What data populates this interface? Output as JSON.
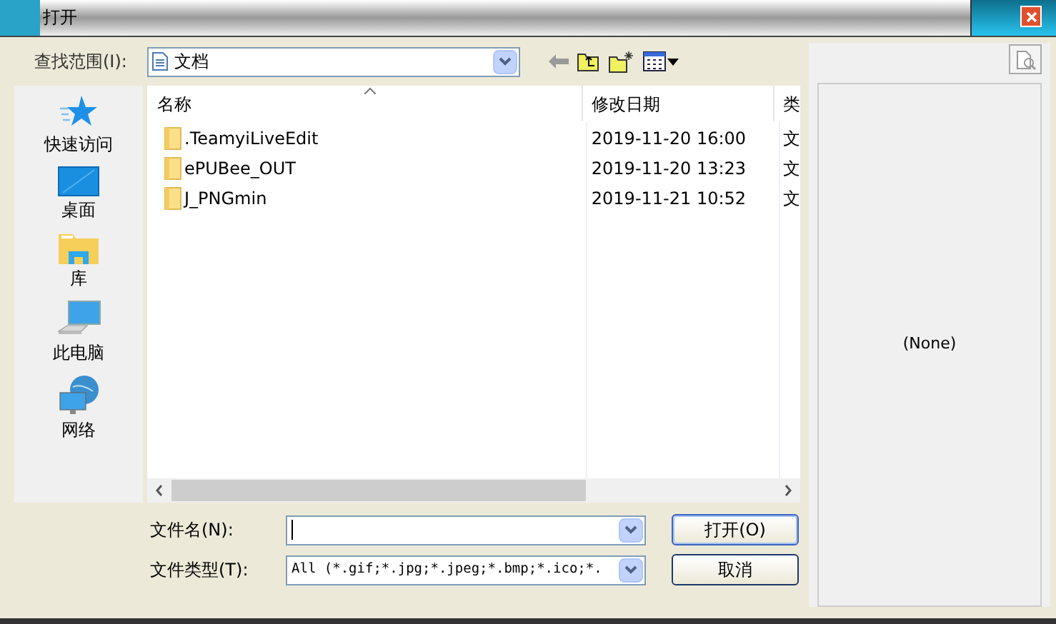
{
  "window": {
    "title": "打开"
  },
  "look_in": {
    "label": "查找范围(I):",
    "value": "文档"
  },
  "places": [
    {
      "label": "快速访问",
      "kind": "star"
    },
    {
      "label": "桌面",
      "kind": "desktop"
    },
    {
      "label": "库",
      "kind": "library"
    },
    {
      "label": "此电脑",
      "kind": "computer"
    },
    {
      "label": "网络",
      "kind": "network"
    }
  ],
  "table": {
    "columns": [
      "名称",
      "修改日期",
      "类"
    ],
    "rows": [
      {
        "name": ".TeamyiLiveEdit",
        "date": "2019-11-20 16:00",
        "column_3": "文"
      },
      {
        "name": "ePUBee_OUT",
        "date": "2019-11-20 13:23",
        "column_3": "文"
      },
      {
        "name": "J_PNGmin",
        "date": "2019-11-21 10:52",
        "column_3": "文"
      }
    ]
  },
  "file_name": {
    "label": "文件名(N):"
  },
  "file_type": {
    "label": "文件类型(T):",
    "value": "All (*.gif;*.jpg;*.jpeg;*.bmp;*.ico;*."
  },
  "buttons": [
    "打开(O)",
    "取消"
  ],
  "preview": {
    "text": "(None)"
  }
}
